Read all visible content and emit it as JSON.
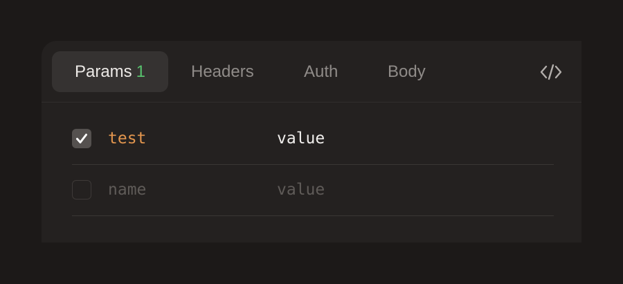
{
  "tabs": {
    "params_label": "Params",
    "params_count": "1",
    "headers_label": "Headers",
    "auth_label": "Auth",
    "body_label": "Body"
  },
  "code_button": {
    "icon": "code-icon"
  },
  "params": [
    {
      "enabled": true,
      "key": "test",
      "value": "value"
    },
    {
      "enabled": false,
      "key_placeholder": "name",
      "value_placeholder": "value"
    }
  ],
  "colors": {
    "background": "#1c1918",
    "panel": "#242120",
    "active_tab": "#353231",
    "count_green": "#58c26e",
    "key_orange": "#e3964e",
    "placeholder": "#5f5b58"
  }
}
